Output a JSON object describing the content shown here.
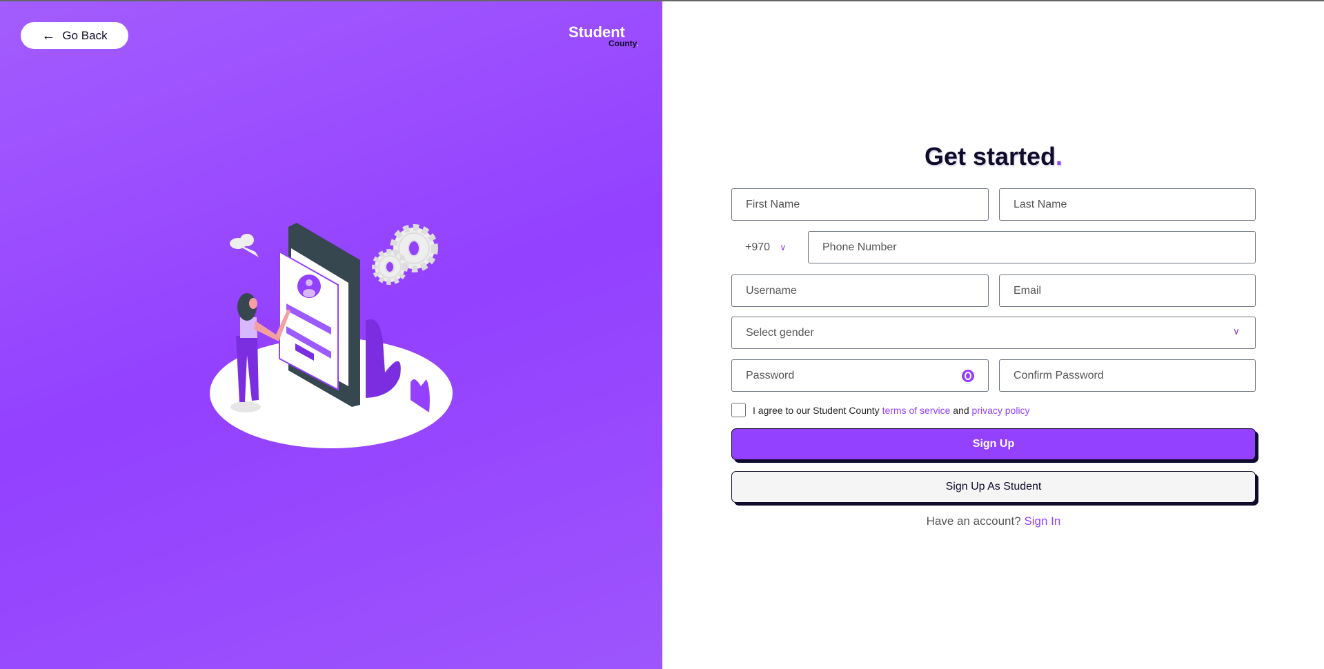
{
  "nav": {
    "go_back_label": "Go Back",
    "back_icon": "arrow-left-icon"
  },
  "logo": {
    "line1": "Student",
    "line2": "County",
    "dot": "."
  },
  "form": {
    "title": "Get started",
    "title_dot": ".",
    "first_name_placeholder": "First Name",
    "last_name_placeholder": "Last Name",
    "country_code": "+970",
    "phone_placeholder": "Phone Number",
    "username_placeholder": "Username",
    "email_placeholder": "Email",
    "gender_placeholder": "Select gender",
    "password_placeholder": "Password",
    "confirm_password_placeholder": "Confirm Password",
    "agree_prefix": "I agree to our Student County",
    "terms_link": "terms of service",
    "agree_and": "and",
    "privacy_link": "privacy policy",
    "signup_label": "Sign Up",
    "signup_student_label": "Sign Up As Student",
    "have_account": "Have an account?",
    "signin_link": "Sign In"
  },
  "colors": {
    "accent": "#9340ff",
    "dark": "#0e0b2b"
  }
}
